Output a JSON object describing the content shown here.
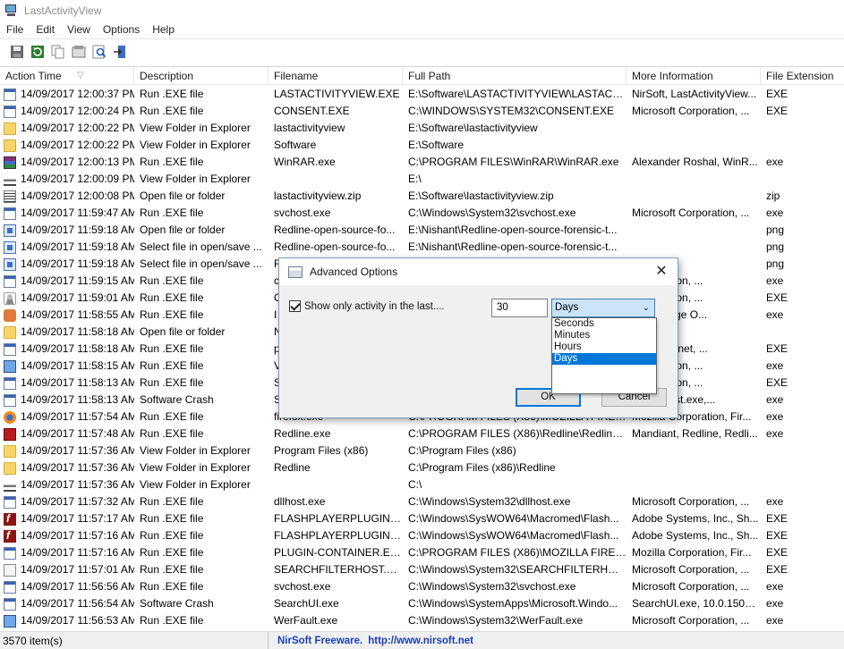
{
  "window": {
    "title": "LastActivityView"
  },
  "menu": [
    "File",
    "Edit",
    "View",
    "Options",
    "Help"
  ],
  "toolbar": {
    "buttons": [
      "save-icon",
      "refresh-icon",
      "copy-icon",
      "properties-icon",
      "find-icon",
      "exit-icon"
    ]
  },
  "table": {
    "columns": [
      "Action Time",
      "Description",
      "Filename",
      "Full Path",
      "More Information",
      "File Extension"
    ],
    "rows": [
      {
        "icon": "exe",
        "time": "14/09/2017 12:00:37 PM",
        "desc": "Run .EXE file",
        "file": "LASTACTIVITYVIEW.EXE",
        "path": "E:\\Software\\LASTACTIVITYVIEW\\LASTACTI...",
        "info": "NirSoft, LastActivityView...",
        "ext": "EXE"
      },
      {
        "icon": "exe",
        "time": "14/09/2017 12:00:24 PM",
        "desc": "Run .EXE file",
        "file": "CONSENT.EXE",
        "path": "C:\\WINDOWS\\SYSTEM32\\CONSENT.EXE",
        "info": "Microsoft Corporation, ...",
        "ext": "EXE"
      },
      {
        "icon": "folder",
        "time": "14/09/2017 12:00:22 PM",
        "desc": "View Folder in Explorer",
        "file": "lastactivityview",
        "path": "E:\\Software\\lastactivityview",
        "info": "",
        "ext": ""
      },
      {
        "icon": "folder",
        "time": "14/09/2017 12:00:22 PM",
        "desc": "View Folder in Explorer",
        "file": "Software",
        "path": "E:\\Software",
        "info": "",
        "ext": ""
      },
      {
        "icon": "rar",
        "time": "14/09/2017 12:00:13 PM",
        "desc": "Run .EXE file",
        "file": "WinRAR.exe",
        "path": "C:\\PROGRAM FILES\\WinRAR\\WinRAR.exe",
        "info": "Alexander Roshal, WinR...",
        "ext": "exe"
      },
      {
        "icon": "drive",
        "time": "14/09/2017 12:00:09 PM",
        "desc": "View Folder in Explorer",
        "file": "",
        "path": "E:\\",
        "info": "",
        "ext": ""
      },
      {
        "icon": "zip",
        "time": "14/09/2017 12:00:08 PM",
        "desc": "Open file or folder",
        "file": "lastactivityview.zip",
        "path": "E:\\Software\\lastactivityview.zip",
        "info": "",
        "ext": "zip"
      },
      {
        "icon": "exe",
        "time": "14/09/2017 11:59:47 AM",
        "desc": "Run .EXE file",
        "file": "svchost.exe",
        "path": "C:\\Windows\\System32\\svchost.exe",
        "info": "Microsoft Corporation, ...",
        "ext": "exe"
      },
      {
        "icon": "img",
        "time": "14/09/2017 11:59:18 AM",
        "desc": "Open file or folder",
        "file": "Redline-open-source-fo...",
        "path": "E:\\Nishant\\Redline-open-source-forensic-t...",
        "info": "",
        "ext": "png"
      },
      {
        "icon": "img",
        "time": "14/09/2017 11:59:18 AM",
        "desc": "Select file in open/save ...",
        "file": "Redline-open-source-fo...",
        "path": "E:\\Nishant\\Redline-open-source-forensic-t...",
        "info": "",
        "ext": "png"
      },
      {
        "icon": "img",
        "time": "14/09/2017 11:59:18 AM",
        "desc": "Select file in open/save ...",
        "file": "R",
        "path": "",
        "info": "",
        "ext": "png"
      },
      {
        "icon": "exe",
        "time": "14/09/2017 11:59:15 AM",
        "desc": "Run .EXE file",
        "file": "c",
        "path": "",
        "info": "Corporation, ...",
        "ext": "exe"
      },
      {
        "icon": "user",
        "time": "14/09/2017 11:59:01 AM",
        "desc": "Run .EXE file",
        "file": "C",
        "path": "",
        "info": "Corporation, ...",
        "ext": "EXE"
      },
      {
        "icon": "gear",
        "time": "14/09/2017 11:58:55 AM",
        "desc": "Run .EXE file",
        "file": "I",
        "path": "",
        "info": "dical Image O...",
        "ext": "exe"
      },
      {
        "icon": "folder",
        "time": "14/09/2017 11:58:18 AM",
        "desc": "Open file or folder",
        "file": "N",
        "path": "",
        "info": "",
        "ext": ""
      },
      {
        "icon": "exe",
        "time": "14/09/2017 11:58:18 AM",
        "desc": "Run .EXE file",
        "file": "p",
        "path": "",
        "info": "LC, paint.net, ...",
        "ext": "EXE"
      },
      {
        "icon": "monitor",
        "time": "14/09/2017 11:58:15 AM",
        "desc": "Run .EXE file",
        "file": "V",
        "path": "",
        "info": "Corporation, ...",
        "ext": "exe"
      },
      {
        "icon": "exe",
        "time": "14/09/2017 11:58:13 AM",
        "desc": "Run .EXE file",
        "file": "S",
        "path": "",
        "info": "Corporation, ...",
        "ext": "EXE"
      },
      {
        "icon": "exe",
        "time": "14/09/2017 11:58:13 AM",
        "desc": "Software Crash",
        "file": "S",
        "path": "",
        "info": "rienceHost.exe,...",
        "ext": "exe"
      },
      {
        "icon": "firefox",
        "time": "14/09/2017 11:57:54 AM",
        "desc": "Run .EXE file",
        "file": "firefox.exe",
        "path": "C:\\PROGRAM FILES (X86)\\MOZILLA FIREFO...",
        "info": "Mozilla Corporation, Fir...",
        "ext": "exe"
      },
      {
        "icon": "redline",
        "time": "14/09/2017 11:57:48 AM",
        "desc": "Run .EXE file",
        "file": "Redline.exe",
        "path": "C:\\PROGRAM FILES (X86)\\Redline\\Redline....",
        "info": "Mandiant, Redline, Redli...",
        "ext": "exe"
      },
      {
        "icon": "folder",
        "time": "14/09/2017 11:57:36 AM",
        "desc": "View Folder in Explorer",
        "file": "Program Files (x86)",
        "path": "C:\\Program Files (x86)",
        "info": "",
        "ext": ""
      },
      {
        "icon": "folder",
        "time": "14/09/2017 11:57:36 AM",
        "desc": "View Folder in Explorer",
        "file": "Redline",
        "path": "C:\\Program Files (x86)\\Redline",
        "info": "",
        "ext": ""
      },
      {
        "icon": "drive",
        "time": "14/09/2017 11:57:36 AM",
        "desc": "View Folder in Explorer",
        "file": "",
        "path": "C:\\",
        "info": "",
        "ext": ""
      },
      {
        "icon": "exe",
        "time": "14/09/2017 11:57:32 AM",
        "desc": "Run .EXE file",
        "file": "dllhost.exe",
        "path": "C:\\Windows\\System32\\dllhost.exe",
        "info": "Microsoft Corporation, ...",
        "ext": "exe"
      },
      {
        "icon": "flash",
        "time": "14/09/2017 11:57:17 AM",
        "desc": "Run .EXE file",
        "file": "FLASHPLAYERPLUGIN_2...",
        "path": "C:\\Windows\\SysWOW64\\Macromed\\Flash...",
        "info": "Adobe Systems, Inc., Sh...",
        "ext": "EXE"
      },
      {
        "icon": "flash",
        "time": "14/09/2017 11:57:16 AM",
        "desc": "Run .EXE file",
        "file": "FLASHPLAYERPLUGIN_2...",
        "path": "C:\\Windows\\SysWOW64\\Macromed\\Flash...",
        "info": "Adobe Systems, Inc., Sh...",
        "ext": "EXE"
      },
      {
        "icon": "exe",
        "time": "14/09/2017 11:57:16 AM",
        "desc": "Run .EXE file",
        "file": "PLUGIN-CONTAINER.EXE",
        "path": "C:\\PROGRAM FILES (X86)\\MOZILLA FIREFO...",
        "info": "Mozilla Corporation, Fir...",
        "ext": "EXE"
      },
      {
        "icon": "search",
        "time": "14/09/2017 11:57:01 AM",
        "desc": "Run .EXE file",
        "file": "SEARCHFILTERHOST.EXE",
        "path": "C:\\Windows\\System32\\SEARCHFILTERHOS...",
        "info": "Microsoft Corporation, ...",
        "ext": "EXE"
      },
      {
        "icon": "exe",
        "time": "14/09/2017 11:56:56 AM",
        "desc": "Run .EXE file",
        "file": "svchost.exe",
        "path": "C:\\Windows\\System32\\svchost.exe",
        "info": "Microsoft Corporation, ...",
        "ext": "exe"
      },
      {
        "icon": "exe",
        "time": "14/09/2017 11:56:54 AM",
        "desc": "Software Crash",
        "file": "SearchUI.exe",
        "path": "C:\\Windows\\SystemApps\\Microsoft.Windo...",
        "info": "SearchUI.exe, 10.0.15063...",
        "ext": "exe"
      },
      {
        "icon": "monitor",
        "time": "14/09/2017 11:56:53 AM",
        "desc": "Run .EXE file",
        "file": "WerFault.exe",
        "path": "C:\\Windows\\System32\\WerFault.exe",
        "info": "Microsoft Corporation, ...",
        "ext": "exe"
      }
    ]
  },
  "status": {
    "count": "3570 item(s)",
    "brand": "NirSoft Freeware.",
    "url": "http://www.nirsoft.net"
  },
  "dialog": {
    "title": "Advanced Options",
    "close_glyph": "✕",
    "checkbox_label": "Show only activity in the last....",
    "checkbox_checked": true,
    "number_value": "30",
    "unit_selected": "Days",
    "unit_options": [
      "Seconds",
      "Minutes",
      "Hours",
      "Days"
    ],
    "ok_label": "OK",
    "cancel_label": "Cancel"
  }
}
